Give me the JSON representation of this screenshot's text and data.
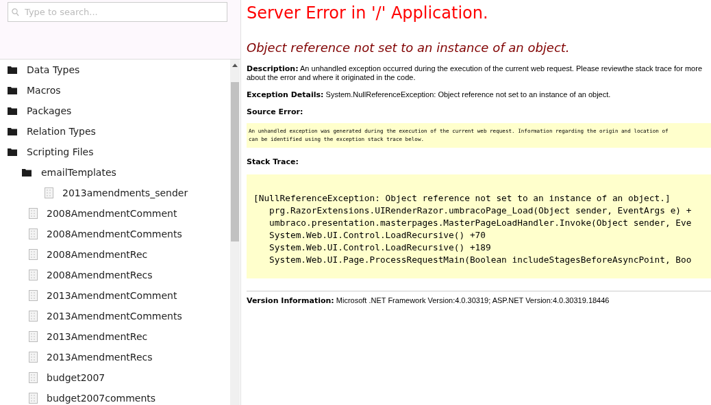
{
  "search": {
    "placeholder": "Type to search..."
  },
  "tree": [
    {
      "label": "Data Types",
      "kind": "folder"
    },
    {
      "label": "Macros",
      "kind": "folder"
    },
    {
      "label": "Packages",
      "kind": "folder"
    },
    {
      "label": "Relation Types",
      "kind": "folder"
    },
    {
      "label": "Scripting Files",
      "kind": "folder",
      "children": [
        {
          "label": "emailTemplates",
          "kind": "folder",
          "children": [
            {
              "label": "2013amendments_sender",
              "kind": "file"
            }
          ]
        },
        {
          "label": "2008AmendmentComment",
          "kind": "file"
        },
        {
          "label": "2008AmendmentComments",
          "kind": "file"
        },
        {
          "label": "2008AmendmentRec",
          "kind": "file"
        },
        {
          "label": "2008AmendmentRecs",
          "kind": "file"
        },
        {
          "label": "2013AmendmentComment",
          "kind": "file"
        },
        {
          "label": "2013AmendmentComments",
          "kind": "file"
        },
        {
          "label": "2013AmendmentRec",
          "kind": "file"
        },
        {
          "label": "2013AmendmentRecs",
          "kind": "file"
        },
        {
          "label": "budget2007",
          "kind": "file"
        },
        {
          "label": "budget2007comments",
          "kind": "file"
        }
      ]
    }
  ],
  "error": {
    "title": "Server Error in '/' Application.",
    "message": "Object reference not set to an instance of an object.",
    "description": {
      "label": "Description:",
      "lines": [
        "An unhandled exception occurred during the execution of the current web request. Please reviewthe stack trace for more",
        "about the error and where it originated in the code."
      ]
    },
    "exception_details": {
      "label": "Exception Details:",
      "text": "System.NullReferenceException: Object reference not set to an instance of an object."
    },
    "source_error": {
      "label": "Source Error:",
      "lines": [
        "An unhandled exception was generated during the execution of the current web request. Information regarding the origin and location of",
        "can be identified using the exception stack trace below."
      ]
    },
    "stack_trace": {
      "label": "Stack Trace:",
      "lines": [
        "[NullReferenceException: Object reference not set to an instance of an object.]",
        "   prg.RazorExtensions.UIRenderRazor.umbracoPage_Load(Object sender, EventArgs e) +",
        "   umbraco.presentation.masterpages.MasterPageLoadHandler.Invoke(Object sender, Eve",
        "   System.Web.UI.Control.LoadRecursive() +70",
        "   System.Web.UI.Control.LoadRecursive() +189",
        "   System.Web.UI.Page.ProcessRequestMain(Boolean includeStagesBeforeAsyncPoint, Boo"
      ]
    },
    "version": {
      "label": "Version Information:",
      "text": "Microsoft .NET Framework Version:4.0.30319; ASP.NET Version:4.0.30319.18446"
    }
  }
}
